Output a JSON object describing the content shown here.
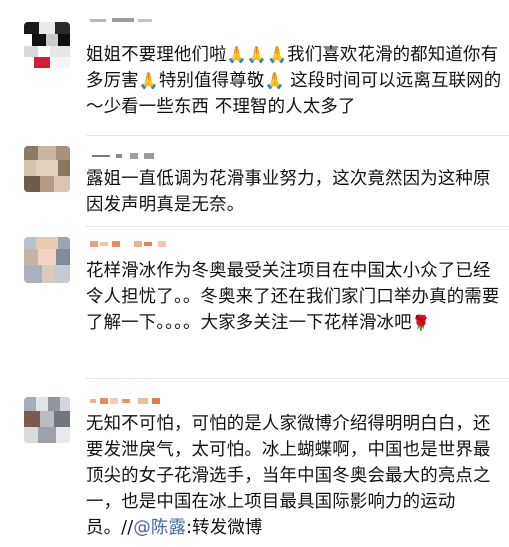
{
  "comments": [
    {
      "id": "c1",
      "text_parts": [
        "姐姐不要理他们啦",
        "🙏🙏🙏",
        "我们喜欢花滑的都知道你有多厉害",
        "🙏",
        "特别值得尊敬",
        "🙏",
        "   这段时间可以远离互联网的～少看一些东西 不理智的人太多了"
      ]
    },
    {
      "id": "c2",
      "text": "露姐一直低调为花滑事业努力，这次竟然因为这种原因发声明真是无奈。"
    },
    {
      "id": "c3",
      "text": "花样滑冰作为冬奥最受关注项目在中国太小众了已经令人担忧了。。冬奥来了还在我们家门口举办真的需要了解一下。。。。大家多关注一下花样滑冰吧",
      "trailing_icon": "rose-icon"
    },
    {
      "id": "c4",
      "text": "无知不可怕，可怕的是人家微博介绍得明明白白，还要发泄戾气，太可怕。冰上蝴蝶啊，中国也是世界最顶尖的女子花滑选手，当年中国冬奥会最大的亮点之一，也是中国在冰上项目最具国际影响力的运动员。//",
      "mention": "@陈露",
      "suffix": ":转发微博"
    }
  ]
}
